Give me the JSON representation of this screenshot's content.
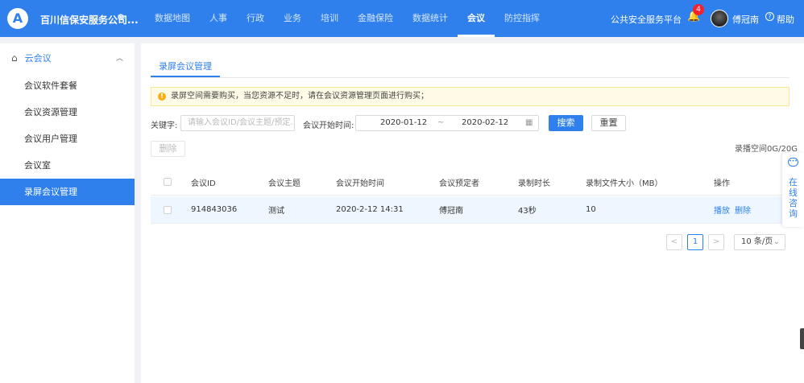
{
  "header": {
    "logo_text": "A",
    "company": "百川信保安服务公司...",
    "nav": [
      "数据地图",
      "人事",
      "行政",
      "业务",
      "培训",
      "金融保险",
      "数据统计",
      "会议",
      "防控指挥"
    ],
    "active_nav": "会议",
    "platform": "公共安全服务平台",
    "notification_count": "4",
    "username": "傅冠南",
    "help": "帮助"
  },
  "sidebar": {
    "group": "云会议",
    "items": [
      "会议软件套餐",
      "会议资源管理",
      "会议用户管理",
      "会议室",
      "录屏会议管理"
    ],
    "active": "录屏会议管理"
  },
  "main": {
    "tab": "录屏会议管理",
    "alert": "录屏空间需要购买，当您资源不足时，请在会议资源管理页面进行购买；",
    "keyword_label": "关键字:",
    "keyword_placeholder": "请输入会议ID/会议主题/预定...",
    "date_label": "会议开始时间:",
    "date_start": "2020-01-12",
    "date_sep": "~",
    "date_end": "2020-02-12",
    "search_button": "搜索",
    "reset_button": "重置",
    "delete_button": "删除",
    "space_info": "录播空间0G/20G"
  },
  "table": {
    "columns": [
      "会议ID",
      "会议主题",
      "会议开始时间",
      "会议预定者",
      "录制时长",
      "录制文件大小（MB）",
      "操作"
    ],
    "rows": [
      {
        "id": "914843036",
        "topic": "测试",
        "start": "2020-2-12 14:31",
        "booker": "傅冠南",
        "duration": "43秒",
        "size": "10",
        "actions": [
          "播放",
          "删除"
        ]
      }
    ]
  },
  "pagination": {
    "prev": "<",
    "current": "1",
    "next": ">",
    "page_size": "10 条/页"
  },
  "float": {
    "text": "在线咨询"
  },
  "colors": {
    "primary": "#2f80ed",
    "warning": "#faad14",
    "badge": "#f5222d"
  }
}
